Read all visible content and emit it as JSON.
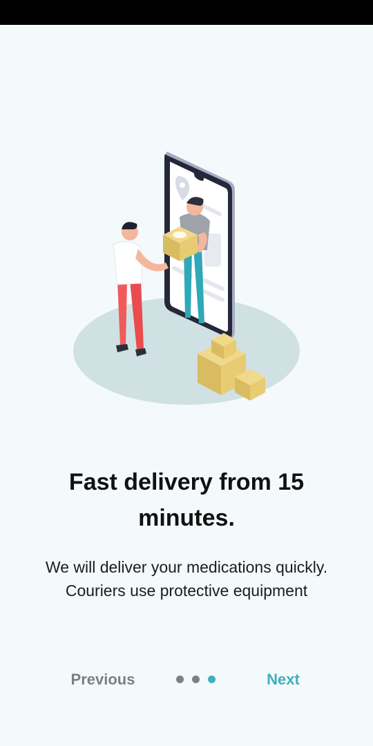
{
  "onboarding": {
    "title": "Fast delivery from 15 minutes.",
    "subtitle": "We will deliver your medications quickly. Couriers use protective equipment"
  },
  "navigation": {
    "previous_label": "Previous",
    "next_label": "Next",
    "page_indicator": {
      "total": 3,
      "active": 3
    }
  },
  "colors": {
    "accent": "#3FB0BC",
    "inactive_dot": "#7C7F84",
    "previous_text": "#7C7F84",
    "background": "#F4F9FB"
  },
  "illustration": {
    "icon": "courier-delivery-illustration"
  }
}
